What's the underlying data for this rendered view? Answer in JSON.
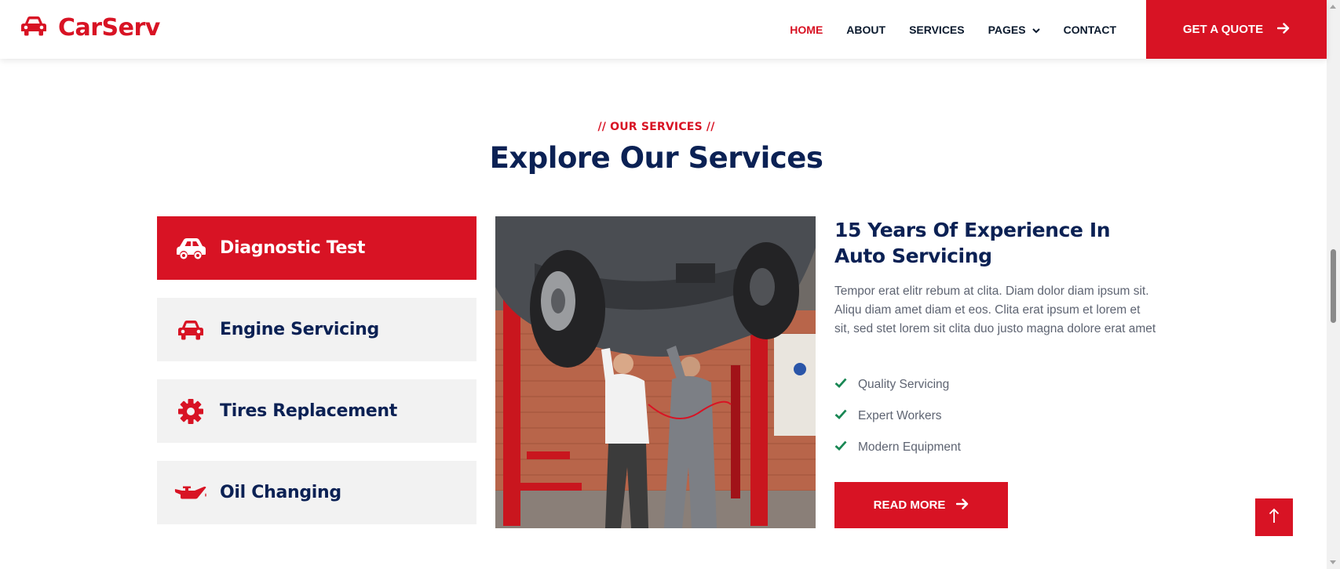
{
  "colors": {
    "primary": "#d81324",
    "dark": "#0b2154",
    "muted": "#5e6472",
    "check": "#198754",
    "tab_bg": "#f2f2f2"
  },
  "nav": {
    "brand": "CarServ",
    "brand_icon": "car-icon",
    "links": [
      {
        "label": "HOME",
        "active": true
      },
      {
        "label": "ABOUT"
      },
      {
        "label": "SERVICES"
      },
      {
        "label": "PAGES",
        "dropdown": true
      },
      {
        "label": "CONTACT"
      }
    ],
    "quote_label": "GET A QUOTE",
    "quote_icon": "arrow-right-icon"
  },
  "section": {
    "subtitle": "// OUR SERVICES //",
    "title": "Explore Our Services"
  },
  "tabs": [
    {
      "label": "Diagnostic Test",
      "icon": "car-side-icon",
      "active": true
    },
    {
      "label": "Engine Servicing",
      "icon": "car-icon"
    },
    {
      "label": "Tires Replacement",
      "icon": "gear-icon"
    },
    {
      "label": "Oil Changing",
      "icon": "oil-can-icon"
    }
  ],
  "detail": {
    "title": "15 Years Of Experience In Auto Servicing",
    "text": "Tempor erat elitr rebum at clita. Diam dolor diam ipsum sit. Aliqu diam amet diam et eos. Clita erat ipsum et lorem et sit, sed stet lorem sit clita duo justo magna dolore erat amet",
    "features": [
      "Quality Servicing",
      "Expert Workers",
      "Modern Equipment"
    ],
    "feature_icon": "check-icon",
    "button_label": "READ MORE",
    "button_icon": "arrow-right-icon"
  },
  "back_to_top_icon": "arrow-up-icon"
}
